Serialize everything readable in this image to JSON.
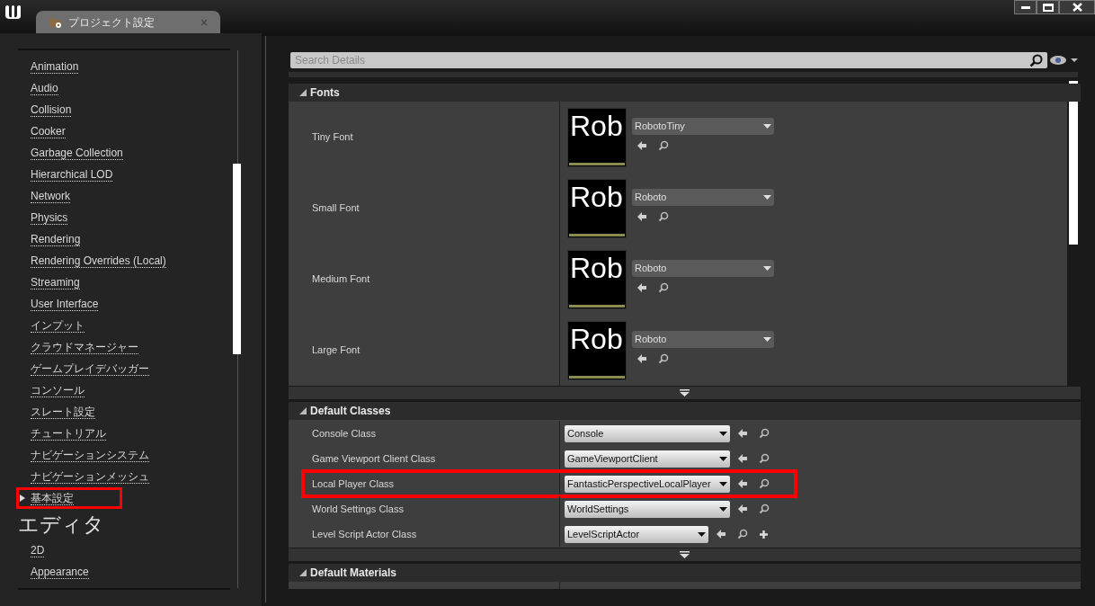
{
  "window": {
    "tab_title": "プロジェクト設定"
  },
  "sidebar": {
    "items": [
      {
        "label": "Animation",
        "highlighted": false
      },
      {
        "label": "Audio",
        "highlighted": false
      },
      {
        "label": "Collision",
        "highlighted": false
      },
      {
        "label": "Cooker",
        "highlighted": false
      },
      {
        "label": "Garbage Collection",
        "highlighted": false
      },
      {
        "label": "Hierarchical LOD",
        "highlighted": false
      },
      {
        "label": "Network",
        "highlighted": false
      },
      {
        "label": "Physics",
        "highlighted": false
      },
      {
        "label": "Rendering",
        "highlighted": false
      },
      {
        "label": "Rendering Overrides (Local)",
        "highlighted": false
      },
      {
        "label": "Streaming",
        "highlighted": false
      },
      {
        "label": "User Interface",
        "highlighted": false
      },
      {
        "label": "インプット",
        "highlighted": false
      },
      {
        "label": "クラウドマネージャー",
        "highlighted": false
      },
      {
        "label": "ゲームプレイデバッガー",
        "highlighted": false
      },
      {
        "label": "コンソール",
        "highlighted": false
      },
      {
        "label": "スレート設定",
        "highlighted": false
      },
      {
        "label": "チュートリアル",
        "highlighted": false
      },
      {
        "label": "ナビゲーションシステム",
        "highlighted": false
      },
      {
        "label": "ナビゲーションメッシュ",
        "highlighted": false
      },
      {
        "label": "基本設定",
        "highlighted": true,
        "expandable": true
      }
    ],
    "section_heading": "エディタ",
    "editor_items": [
      {
        "label": "2D"
      },
      {
        "label": "Appearance"
      }
    ]
  },
  "search": {
    "placeholder": "Search Details"
  },
  "fonts": {
    "title": "Fonts",
    "rows": [
      {
        "label": "Tiny Font",
        "preview": "Rob",
        "value": "RobotoTiny"
      },
      {
        "label": "Small Font",
        "preview": "Rob",
        "value": "Roboto"
      },
      {
        "label": "Medium Font",
        "preview": "Rob",
        "value": "Roboto"
      },
      {
        "label": "Large Font",
        "preview": "Rob",
        "value": "Roboto"
      }
    ]
  },
  "default_classes": {
    "title": "Default Classes",
    "rows": [
      {
        "label": "Console Class",
        "value": "Console",
        "highlighted": false,
        "addable": false
      },
      {
        "label": "Game Viewport Client Class",
        "value": "GameViewportClient",
        "highlighted": false,
        "addable": false
      },
      {
        "label": "Local Player Class",
        "value": "FantasticPerspectiveLocalPlayer",
        "highlighted": true,
        "addable": false
      },
      {
        "label": "World Settings Class",
        "value": "WorldSettings",
        "highlighted": false,
        "addable": false
      },
      {
        "label": "Level Script Actor Class",
        "value": "LevelScriptActor",
        "highlighted": false,
        "addable": true
      }
    ]
  },
  "default_materials": {
    "title": "Default Materials"
  }
}
